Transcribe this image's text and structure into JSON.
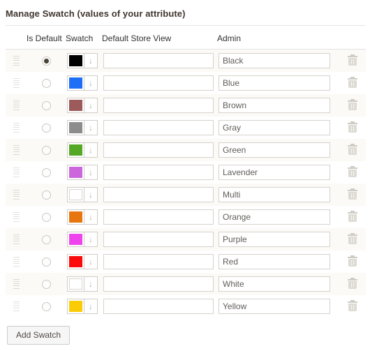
{
  "panel": {
    "title": "Manage Swatch (values of your attribute)"
  },
  "table": {
    "headers": {
      "drag": "",
      "is_default": "Is Default",
      "swatch": "Swatch",
      "default_store_view": "Default Store View",
      "admin": "Admin",
      "delete": ""
    },
    "arrow_glyph": "↓",
    "rows": [
      {
        "is_default": true,
        "swatch_color": "#000000",
        "swatch_empty": false,
        "store_view": "",
        "admin": "Black"
      },
      {
        "is_default": false,
        "swatch_color": "#1F6EF6",
        "swatch_empty": false,
        "store_view": "",
        "admin": "Blue"
      },
      {
        "is_default": false,
        "swatch_color": "#9C5A5A",
        "swatch_empty": false,
        "store_view": "",
        "admin": "Brown"
      },
      {
        "is_default": false,
        "swatch_color": "#8C8C8C",
        "swatch_empty": false,
        "store_view": "",
        "admin": "Gray"
      },
      {
        "is_default": false,
        "swatch_color": "#55A825",
        "swatch_empty": false,
        "store_view": "",
        "admin": "Green"
      },
      {
        "is_default": false,
        "swatch_color": "#CC66DD",
        "swatch_empty": false,
        "store_view": "",
        "admin": "Lavender"
      },
      {
        "is_default": false,
        "swatch_color": "#FFFFFF",
        "swatch_empty": true,
        "store_view": "",
        "admin": "Multi"
      },
      {
        "is_default": false,
        "swatch_color": "#E8760F",
        "swatch_empty": false,
        "store_view": "",
        "admin": "Orange"
      },
      {
        "is_default": false,
        "swatch_color": "#EE44EE",
        "swatch_empty": false,
        "store_view": "",
        "admin": "Purple"
      },
      {
        "is_default": false,
        "swatch_color": "#FA0A0A",
        "swatch_empty": false,
        "store_view": "",
        "admin": "Red"
      },
      {
        "is_default": false,
        "swatch_color": "#FFFFFF",
        "swatch_empty": true,
        "store_view": "",
        "admin": "White"
      },
      {
        "is_default": false,
        "swatch_color": "#FACC06",
        "swatch_empty": false,
        "store_view": "",
        "admin": "Yellow"
      }
    ]
  },
  "footer": {
    "add_swatch_label": "Add Swatch"
  },
  "colors": {
    "title_text": "#41362F",
    "row_odd_bg": "#FBFAF6",
    "row_even_bg": "#FFFFFF",
    "border": "#E3E3E3",
    "input_border": "#D6D3CD",
    "radio_dot": "#494236",
    "trash": "#DEDBD5"
  }
}
